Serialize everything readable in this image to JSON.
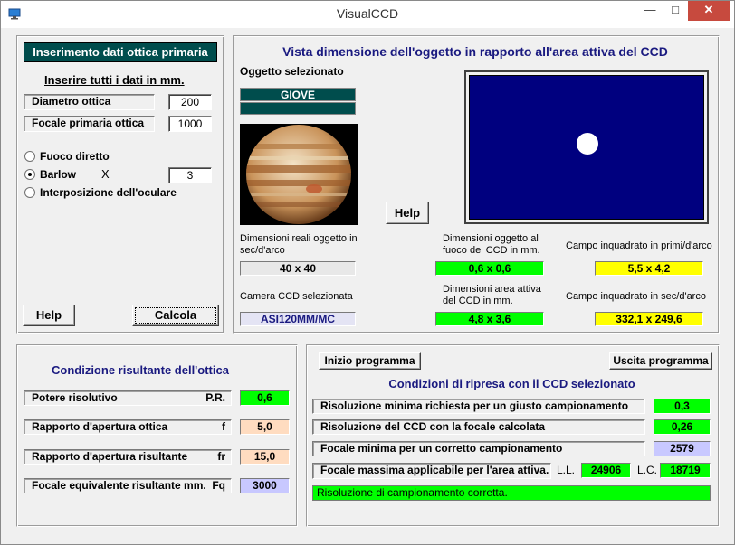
{
  "window": {
    "title": "VisualCCD"
  },
  "titlebar": {
    "minimize": "—",
    "maximize": "□",
    "close": "✕"
  },
  "left_panel": {
    "header": "Inserimento dati ottica primaria",
    "subtitle": "Inserire tutti i dati in mm.",
    "diameter_label": "Diametro ottica",
    "diameter_value": "200",
    "focal_label": "Focale primaria ottica",
    "focal_value": "1000",
    "radio_direct": "Fuoco diretto",
    "radio_barlow": "Barlow",
    "barlow_x": "X",
    "barlow_value": "3",
    "radio_eyepiece": "Interposizione dell'oculare",
    "help_button": "Help",
    "calc_button": "Calcola"
  },
  "view_panel": {
    "title": "Vista  dimensione dell'oggetto in rapporto all'area attiva del CCD",
    "selected_label": "Oggetto selezionato",
    "object_name": "GIOVE",
    "object_name2": "",
    "help_button": "Help",
    "real_dim_label": "Dimensioni reali oggetto in sec/d'arco",
    "real_dim_value": "40 x 40",
    "ccd_focus_label": "Dimensioni oggetto al fuoco del CCD in mm.",
    "ccd_focus_value": "0,6 x 0,6",
    "field_min_label": "Campo inquadrato in primi/d'arco",
    "field_min_value": "5,5 x 4,2",
    "camera_label": "Camera CCD selezionata",
    "camera_value": "ASI120MM/MC",
    "ccd_area_label": "Dimensioni area attiva del CCD in mm.",
    "ccd_area_value": "4,8 x 3,6",
    "field_sec_label": "Campo inquadrato in sec/d'arco",
    "field_sec_value": "332,1 x 249,6"
  },
  "optics_panel": {
    "title": "Condizione risultante dell'ottica",
    "rows": [
      {
        "label": "Potere risolutivo",
        "symbol": "P.R.",
        "value": "0,6"
      },
      {
        "label": "Rapporto d'apertura ottica",
        "symbol": "f",
        "value": "5,0"
      },
      {
        "label": "Rapporto d'apertura risultante",
        "symbol": "fr",
        "value": "15,0"
      },
      {
        "label": "Focale equivalente risultante  mm.",
        "symbol": "Fq",
        "value": "3000"
      }
    ]
  },
  "ccd_panel": {
    "start_button": "Inizio  programma",
    "exit_button": "Uscita programma",
    "title": "Condizioni  di  ripresa  con  il  CCD  selezionato",
    "rows": [
      {
        "label": "Risoluzione minima richiesta per un giusto campionamento",
        "value": "0,3"
      },
      {
        "label": "Risoluzione del CCD con la focale calcolata",
        "value": "0,26"
      },
      {
        "label": "Focale minima per un corretto campionamento",
        "value": "2579"
      },
      {
        "label": "Focale massima applicabile per l'area attiva.",
        "ll_label": "L.L.",
        "ll_value": "24906",
        "lc_label": "L.C.",
        "lc_value": "18719"
      }
    ],
    "status": "Risoluzione di campionamento corretta."
  },
  "colors": {
    "green": "#00ff00",
    "yellow": "#ffff00",
    "peach": "#ffdcc0",
    "lavender": "#c8c8ff",
    "ccd_blue": "#00007f",
    "header_teal": "#004d4d"
  }
}
